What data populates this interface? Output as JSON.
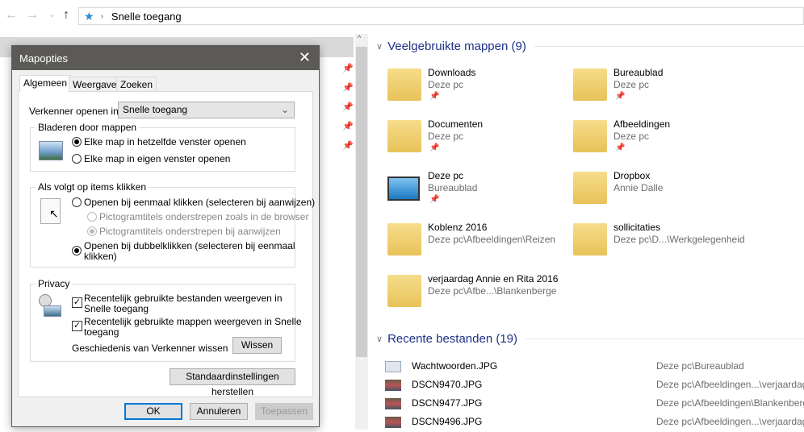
{
  "nav": {
    "back": "←",
    "forward": "→",
    "recent": "⌄",
    "up": "↑",
    "breadcrumb": "Snelle toegang"
  },
  "frequent": {
    "title": "Veelgebruikte mappen (9)",
    "folders": [
      {
        "name": "Downloads",
        "sub": "Deze pc",
        "pinned": true
      },
      {
        "name": "Bureaublad",
        "sub": "Deze pc",
        "pinned": true
      },
      {
        "name": "Documenten",
        "sub": "Deze pc",
        "pinned": true
      },
      {
        "name": "Afbeeldingen",
        "sub": "Deze pc",
        "pinned": true
      },
      {
        "name": "Deze pc",
        "sub": "Bureaublad",
        "pinned": true
      },
      {
        "name": "Dropbox",
        "sub": "Annie Dalle",
        "pinned": false
      },
      {
        "name": "Koblenz 2016",
        "sub": "Deze pc\\Afbeeldingen\\Reizen",
        "pinned": false
      },
      {
        "name": "sollicitaties",
        "sub": "Deze pc\\D...\\Werkgelegenheid",
        "pinned": false
      },
      {
        "name": "verjaardag Annie en Rita 2016",
        "sub": "Deze pc\\Afbe...\\Blankenberge",
        "pinned": false
      }
    ]
  },
  "recent": {
    "title": "Recente bestanden (19)",
    "files": [
      {
        "name": "Wachtwoorden.JPG",
        "path": "Deze pc\\Bureaublad"
      },
      {
        "name": "DSCN9470.JPG",
        "path": "Deze pc\\Afbeeldingen...\\verjaardag"
      },
      {
        "name": "DSCN9477.JPG",
        "path": "Deze pc\\Afbeeldingen\\Blankenberg"
      },
      {
        "name": "DSCN9496.JPG",
        "path": "Deze pc\\Afbeeldingen...\\verjaardag"
      }
    ]
  },
  "dialog": {
    "title": "Mapopties",
    "tabs": [
      "Algemeen",
      "Weergave",
      "Zoeken"
    ],
    "open_in_label": "Verkenner openen in:",
    "open_in_value": "Snelle toegang",
    "browse": {
      "title": "Bladeren door mappen",
      "opt1": "Elke map in hetzelfde venster openen",
      "opt2": "Elke map in eigen venster openen"
    },
    "click": {
      "title": "Als volgt op items klikken",
      "single": "Openen bij eenmaal klikken (selecteren bij aanwijzen)",
      "sub1": "Pictogramtitels onderstrepen zoals in de browser",
      "sub2": "Pictogramtitels onderstrepen bij aanwijzen",
      "double1": "Openen bij dubbelklikken (selecteren bij eenmaal",
      "double2": "klikken)"
    },
    "privacy": {
      "title": "Privacy",
      "files1": "Recentelijk gebruikte bestanden weergeven in",
      "files2": "Snelle toegang",
      "folders1": "Recentelijk gebruikte mappen weergeven in Snelle",
      "folders2": "toegang",
      "history": "Geschiedenis van Verkenner wissen",
      "clear": "Wissen"
    },
    "restore": "Standaardinstellingen herstellen",
    "ok": "OK",
    "cancel": "Annuleren",
    "apply": "Toepassen"
  }
}
